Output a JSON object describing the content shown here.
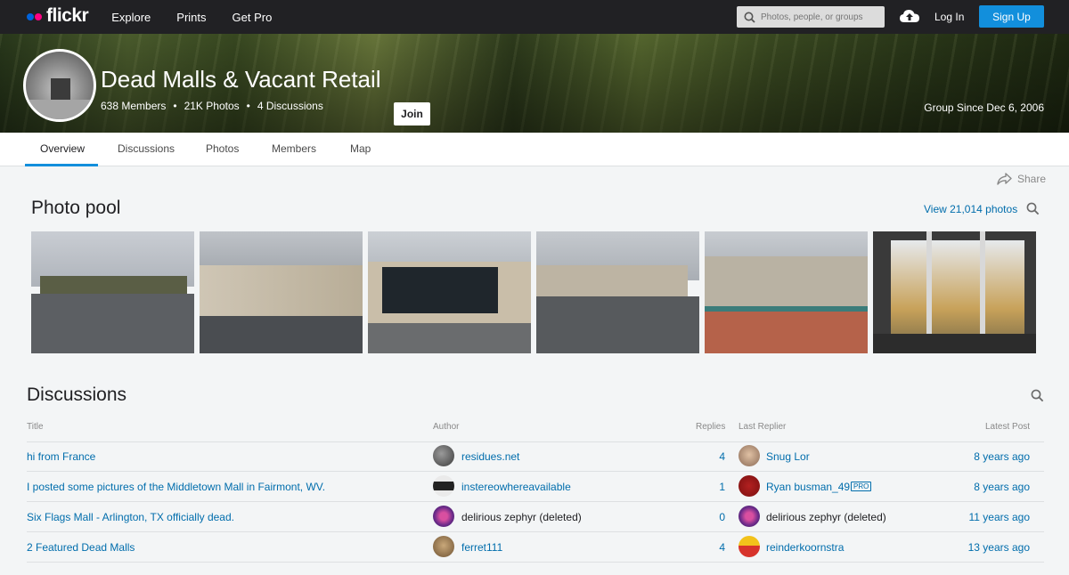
{
  "nav": {
    "logo_text": "flickr",
    "links": [
      "Explore",
      "Prints",
      "Get Pro"
    ],
    "search_placeholder": "Photos, people, or groups",
    "login": "Log In",
    "signup": "Sign Up"
  },
  "group": {
    "name": "Dead Malls & Vacant Retail",
    "join": "Join",
    "members": "638 Members",
    "photos": "21K Photos",
    "discussions": "4 Discussions",
    "stat_sep": "•",
    "since": "Group Since Dec 6, 2006"
  },
  "tabs": [
    "Overview",
    "Discussions",
    "Photos",
    "Members",
    "Map"
  ],
  "share_label": "Share",
  "photo_pool": {
    "title": "Photo pool",
    "view_all": "View 21,014 photos"
  },
  "discussions": {
    "title": "Discussions",
    "headers": {
      "title": "Title",
      "author": "Author",
      "replies": "Replies",
      "last_replier": "Last Replier",
      "latest_post": "Latest Post"
    },
    "rows": [
      {
        "title": "hi from France",
        "author": "residues.net",
        "replies": "4",
        "last_replier": "Snug Lor",
        "latest": "8 years ago"
      },
      {
        "title": "I posted some pictures of the Middletown Mall in Fairmont, WV.",
        "author": "instereowhereavailable",
        "replies": "1",
        "last_replier": "Ryan busman_49",
        "latest": "8 years ago",
        "pro": "PRO"
      },
      {
        "title": "Six Flags Mall - Arlington, TX officially dead.",
        "author": "delirious zephyr (deleted)",
        "replies": "0",
        "last_replier": "delirious zephyr (deleted)",
        "latest": "11 years ago"
      },
      {
        "title": "2 Featured Dead Malls",
        "author": "ferret111",
        "replies": "4",
        "last_replier": "reinderkoornstra",
        "latest": "13 years ago"
      }
    ]
  },
  "colors": {
    "accent": "#128fdc",
    "link": "#006dac",
    "nav_bg": "#212124"
  }
}
